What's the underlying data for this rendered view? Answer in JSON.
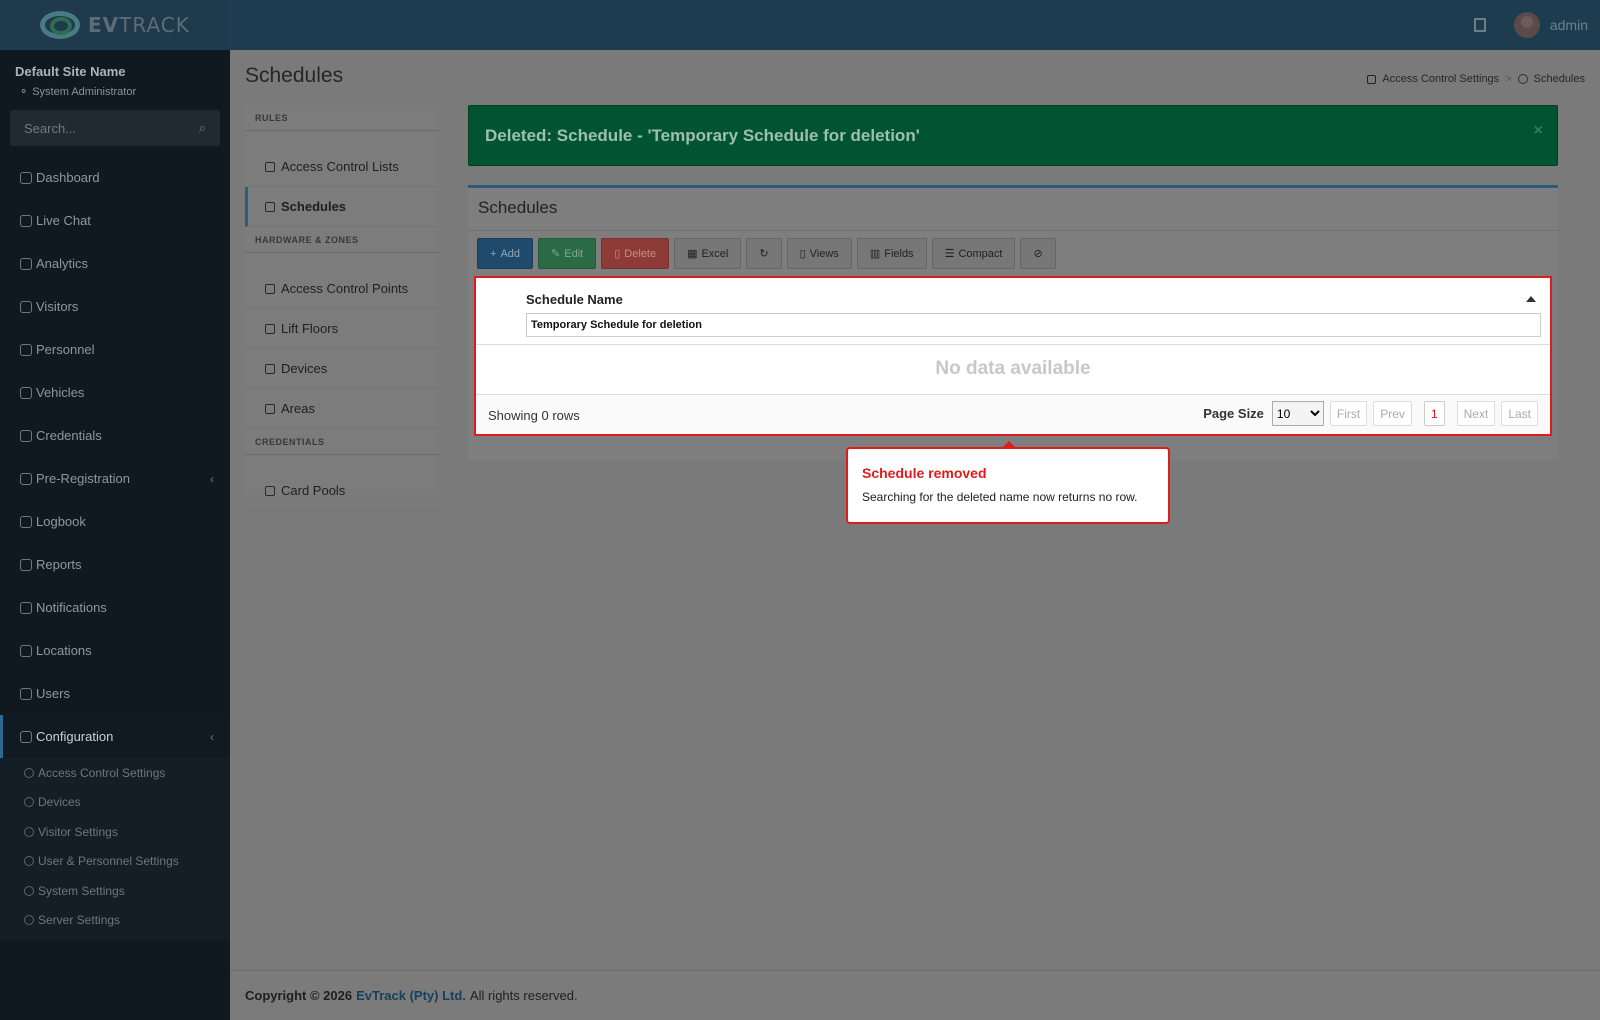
{
  "header": {
    "brand_prefix": "EV",
    "brand_suffix": "TRACK",
    "user_name": "admin"
  },
  "sidebar": {
    "site_name": "Default Site Name",
    "user_role": "System Administrator",
    "search_placeholder": "Search...",
    "items": [
      {
        "label": "Dashboard",
        "icon": "dashboard-icon"
      },
      {
        "label": "Live Chat",
        "icon": "headset-icon"
      },
      {
        "label": "Analytics",
        "icon": "target-icon"
      },
      {
        "label": "Visitors",
        "icon": "eye-icon"
      },
      {
        "label": "Personnel",
        "icon": "person-icon"
      },
      {
        "label": "Vehicles",
        "icon": "car-icon"
      },
      {
        "label": "Credentials",
        "icon": "id-card-icon"
      },
      {
        "label": "Pre-Registration",
        "icon": "swap-icon"
      },
      {
        "label": "Logbook",
        "icon": "book-icon"
      },
      {
        "label": "Reports",
        "icon": "chart-icon"
      },
      {
        "label": "Notifications",
        "icon": "message-icon"
      },
      {
        "label": "Locations",
        "icon": "map-icon"
      },
      {
        "label": "Users",
        "icon": "users-icon"
      },
      {
        "label": "Configuration",
        "icon": "gear-icon"
      }
    ],
    "sub_items": [
      {
        "label": "Access Control Settings",
        "icon": "lock-icon"
      },
      {
        "label": "Devices",
        "icon": "gear-icon"
      },
      {
        "label": "Visitor Settings",
        "icon": "eye-icon"
      },
      {
        "label": "User & Personnel Settings",
        "icon": "user-gear-icon"
      },
      {
        "label": "System Settings",
        "icon": "sliders-icon"
      },
      {
        "label": "Server Settings",
        "icon": "server-icon"
      }
    ]
  },
  "page": {
    "title": "Schedules",
    "breadcrumb": [
      "Access Control Settings",
      ">",
      "Schedules"
    ]
  },
  "rules_panel": {
    "sections": [
      {
        "heading": "RULES",
        "items": [
          "Access Control Lists",
          "Schedules"
        ]
      },
      {
        "heading": "HARDWARE & ZONES",
        "items": [
          "Access Control Points",
          "Lift Floors",
          "Devices",
          "Areas"
        ]
      },
      {
        "heading": "CREDENTIALS",
        "items": [
          "Card Pools"
        ]
      }
    ]
  },
  "alert": {
    "message": "Deleted: Schedule - 'Temporary Schedule for deletion'",
    "close": "×"
  },
  "box": {
    "title": "Schedules",
    "toolbar": {
      "add": "Add",
      "edit": "Edit",
      "delete": "Delete",
      "excel": "Excel",
      "views": "Views",
      "fields": "Fields",
      "compact": "Compact"
    },
    "grid": {
      "column": "Schedule Name",
      "filter_value": "Temporary Schedule for deletion",
      "empty": "No data available",
      "showing": "Showing 0 rows",
      "page_size_label": "Page Size",
      "page_size": "10",
      "first": "First",
      "prev": "Prev",
      "current_page": "1",
      "next": "Next",
      "last": "Last"
    }
  },
  "callout": {
    "title": "Schedule removed",
    "text": "Searching for the deleted name now returns no row."
  },
  "footer": {
    "copyright": "Copyright © 2026",
    "company": "EvTrack (Pty) Ltd.",
    "rights": "All rights reserved."
  }
}
